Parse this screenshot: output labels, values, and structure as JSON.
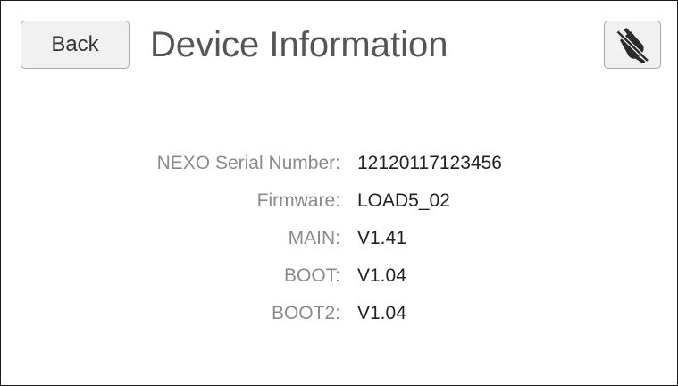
{
  "header": {
    "back_label": "Back",
    "title": "Device Information",
    "connection_icon": "disconnected-plug-icon"
  },
  "device_info": {
    "rows": [
      {
        "label": "NEXO Serial Number:",
        "value": "12120117123456"
      },
      {
        "label": "Firmware:",
        "value": "LOAD5_02"
      },
      {
        "label": "MAIN:",
        "value": "V1.41"
      },
      {
        "label": "BOOT:",
        "value": "V1.04"
      },
      {
        "label": "BOOT2:",
        "value": "V1.04"
      }
    ]
  },
  "colors": {
    "title_text": "#555555",
    "label_text": "#8a8a8a",
    "value_text": "#222222",
    "button_background": "#f1f1f1",
    "button_border": "#a9a9a9"
  }
}
